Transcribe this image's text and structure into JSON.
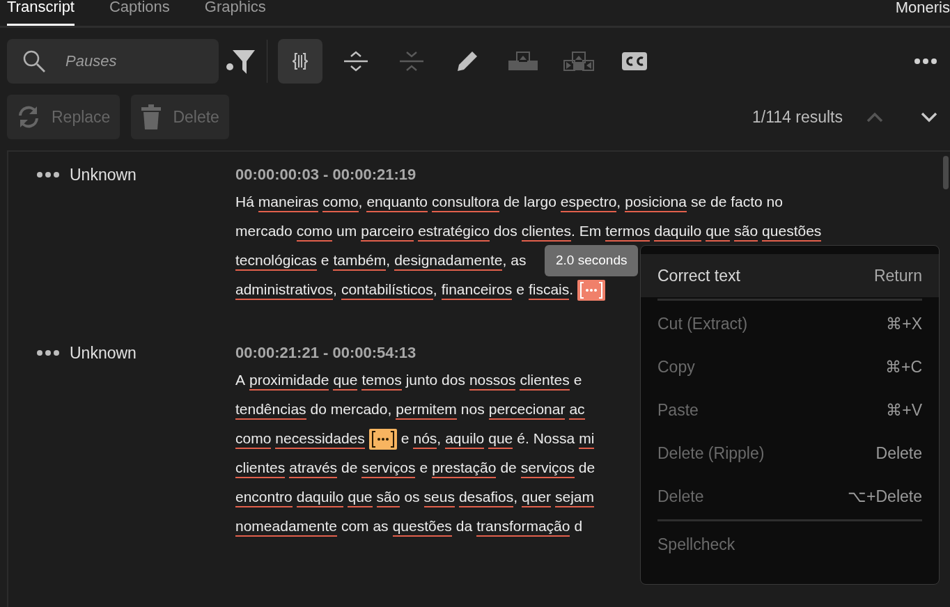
{
  "tabs": [
    {
      "label": "Transcript",
      "selected": true
    },
    {
      "label": "Captions",
      "selected": false
    },
    {
      "label": "Graphics",
      "selected": false
    }
  ],
  "project": "Moneris",
  "search": {
    "value": "Pauses"
  },
  "toolbar": [
    {
      "kind": "pauses",
      "selected": true,
      "disabled": false
    },
    {
      "kind": "expand",
      "selected": false,
      "disabled": false
    },
    {
      "kind": "collapse",
      "selected": false,
      "disabled": true
    },
    {
      "kind": "edit",
      "selected": false,
      "disabled": false
    },
    {
      "kind": "export-up",
      "selected": false,
      "disabled": true
    },
    {
      "kind": "export-sides",
      "selected": false,
      "disabled": true
    },
    {
      "kind": "captions",
      "selected": false,
      "disabled": false
    }
  ],
  "actions": [
    {
      "kind": "replace",
      "label": "Replace",
      "disabled": true
    },
    {
      "kind": "delete",
      "label": "Delete",
      "disabled": true
    }
  ],
  "results": "1/114 results",
  "nav": [
    {
      "kind": "up",
      "disabled": true
    },
    {
      "kind": "down",
      "disabled": false
    }
  ],
  "segments": [
    {
      "speaker": "Unknown",
      "timecode": "00:00:00:03 - 00:00:21:19",
      "lines": [
        [
          {
            "kind": "word",
            "text": "Há",
            "flagged": false
          },
          {
            "kind": "word",
            "text": "maneiras",
            "flagged": true
          },
          {
            "kind": "word",
            "text": "como",
            "tail": ",",
            "flagged": true
          },
          {
            "kind": "word",
            "text": "enquanto",
            "flagged": true
          },
          {
            "kind": "word",
            "text": "consultora",
            "flagged": true
          },
          {
            "kind": "word",
            "text": "de largo",
            "flagged": false
          },
          {
            "kind": "word",
            "text": "espectro",
            "tail": ",",
            "flagged": true
          },
          {
            "kind": "word",
            "text": "posiciona",
            "flagged": true
          },
          {
            "kind": "word",
            "text": "se de facto no",
            "flagged": false
          }
        ],
        [
          {
            "kind": "word",
            "text": "mercado",
            "flagged": false
          },
          {
            "kind": "word",
            "text": "como",
            "flagged": true
          },
          {
            "kind": "word",
            "text": "um",
            "flagged": false
          },
          {
            "kind": "word",
            "text": "parceiro",
            "flagged": true
          },
          {
            "kind": "word",
            "text": "estratégico",
            "flagged": true
          },
          {
            "kind": "word",
            "text": "dos",
            "flagged": false
          },
          {
            "kind": "word",
            "text": "clientes",
            "tail": ".",
            "flagged": true
          },
          {
            "kind": "word",
            "text": "Em",
            "flagged": false
          },
          {
            "kind": "word",
            "text": "termos",
            "flagged": true
          },
          {
            "kind": "word",
            "text": "daquilo",
            "flagged": true
          },
          {
            "kind": "word",
            "text": "que",
            "flagged": true
          },
          {
            "kind": "word",
            "text": "são",
            "flagged": true
          },
          {
            "kind": "word",
            "text": "questões",
            "flagged": true
          }
        ],
        [
          {
            "kind": "word",
            "text": "tecnológicas",
            "flagged": true
          },
          {
            "kind": "word",
            "text": "e",
            "flagged": false
          },
          {
            "kind": "word",
            "text": "também",
            "tail": ",",
            "flagged": true
          },
          {
            "kind": "word",
            "text": "designadamente",
            "tail": ",",
            "flagged": true
          },
          {
            "kind": "word",
            "text": "as",
            "flagged": false
          }
        ],
        [
          {
            "kind": "word",
            "text": "administrativos",
            "tail": ",",
            "flagged": true
          },
          {
            "kind": "word",
            "text": "contabilísticos",
            "tail": ",",
            "flagged": true
          },
          {
            "kind": "word",
            "text": "financeiros",
            "flagged": true
          },
          {
            "kind": "word",
            "text": "e",
            "flagged": false
          },
          {
            "kind": "word",
            "text": "fiscais",
            "tail": ".",
            "flagged": true
          },
          {
            "kind": "pause",
            "active": true
          }
        ]
      ]
    },
    {
      "speaker": "Unknown",
      "timecode": "00:00:21:21 - 00:00:54:13",
      "lines": [
        [
          {
            "kind": "word",
            "text": "A",
            "flagged": false
          },
          {
            "kind": "word",
            "text": "proximidade",
            "flagged": true
          },
          {
            "kind": "word",
            "text": "que",
            "flagged": true
          },
          {
            "kind": "word",
            "text": "temos",
            "flagged": true
          },
          {
            "kind": "word",
            "text": "junto dos",
            "flagged": false
          },
          {
            "kind": "word",
            "text": "nossos",
            "flagged": true
          },
          {
            "kind": "word",
            "text": "clientes",
            "flagged": true
          },
          {
            "kind": "word",
            "text": "e",
            "flagged": false
          }
        ],
        [
          {
            "kind": "word",
            "text": "tendências",
            "flagged": true
          },
          {
            "kind": "word",
            "text": "do mercado,",
            "flagged": false
          },
          {
            "kind": "word",
            "text": "permitem",
            "flagged": true
          },
          {
            "kind": "word",
            "text": "nos",
            "flagged": false
          },
          {
            "kind": "word",
            "text": "percecionar",
            "flagged": true
          },
          {
            "kind": "word",
            "text": "ac",
            "flagged": true
          }
        ],
        [
          {
            "kind": "word",
            "text": "como",
            "flagged": true
          },
          {
            "kind": "word",
            "text": "necessidades",
            "flagged": true
          },
          {
            "kind": "pause",
            "active": false
          },
          {
            "kind": "word",
            "text": "e",
            "flagged": false
          },
          {
            "kind": "word",
            "text": "nós",
            "tail": ",",
            "flagged": true
          },
          {
            "kind": "word",
            "text": "aquilo",
            "flagged": true
          },
          {
            "kind": "word",
            "text": "que",
            "flagged": true
          },
          {
            "kind": "word",
            "text": "é. Nossa",
            "flagged": false
          },
          {
            "kind": "word",
            "text": "mi",
            "flagged": true
          }
        ],
        [
          {
            "kind": "word",
            "text": "clientes",
            "flagged": true
          },
          {
            "kind": "word",
            "text": "através",
            "flagged": true
          },
          {
            "kind": "word",
            "text": "de",
            "flagged": false
          },
          {
            "kind": "word",
            "text": "serviços",
            "flagged": true
          },
          {
            "kind": "word",
            "text": "e",
            "flagged": false
          },
          {
            "kind": "word",
            "text": "prestação",
            "flagged": true
          },
          {
            "kind": "word",
            "text": "de",
            "flagged": false
          },
          {
            "kind": "word",
            "text": "serviços",
            "flagged": true
          },
          {
            "kind": "word",
            "text": "de",
            "flagged": false
          }
        ],
        [
          {
            "kind": "word",
            "text": "encontro",
            "flagged": true
          },
          {
            "kind": "word",
            "text": "daquilo",
            "flagged": true
          },
          {
            "kind": "word",
            "text": "que",
            "flagged": true
          },
          {
            "kind": "word",
            "text": "são",
            "flagged": true
          },
          {
            "kind": "word",
            "text": "os",
            "flagged": false
          },
          {
            "kind": "word",
            "text": "seus",
            "flagged": true
          },
          {
            "kind": "word",
            "text": "desafios",
            "tail": ",",
            "flagged": true
          },
          {
            "kind": "word",
            "text": "quer",
            "flagged": true
          },
          {
            "kind": "word",
            "text": "sejam",
            "flagged": true
          }
        ],
        [
          {
            "kind": "word",
            "text": "nomeadamente",
            "flagged": true
          },
          {
            "kind": "word",
            "text": "com as",
            "flagged": false
          },
          {
            "kind": "word",
            "text": "questões",
            "flagged": true
          },
          {
            "kind": "word",
            "text": "da",
            "flagged": false
          },
          {
            "kind": "word",
            "text": "transformação",
            "flagged": true
          },
          {
            "kind": "word",
            "text": "d",
            "flagged": false
          }
        ]
      ]
    }
  ],
  "tooltip": "2.0 seconds",
  "context_menu": [
    {
      "kind": "item",
      "label": "Correct text",
      "shortcut": "Return",
      "selected": true,
      "disabled": false
    },
    {
      "kind": "separator"
    },
    {
      "kind": "item",
      "label": "Cut (Extract)",
      "shortcut": "⌘+X",
      "selected": false,
      "disabled": true
    },
    {
      "kind": "item",
      "label": "Copy",
      "shortcut": "⌘+C",
      "selected": false,
      "disabled": true
    },
    {
      "kind": "item",
      "label": "Paste",
      "shortcut": "⌘+V",
      "selected": false,
      "disabled": true
    },
    {
      "kind": "item",
      "label": "Delete (Ripple)",
      "shortcut": "Delete",
      "selected": false,
      "disabled": true
    },
    {
      "kind": "item",
      "label": "Delete",
      "shortcut": "⌥+Delete",
      "selected": false,
      "disabled": true
    },
    {
      "kind": "separator"
    },
    {
      "kind": "item",
      "label": "Spellcheck",
      "selected": false,
      "disabled": true
    }
  ]
}
